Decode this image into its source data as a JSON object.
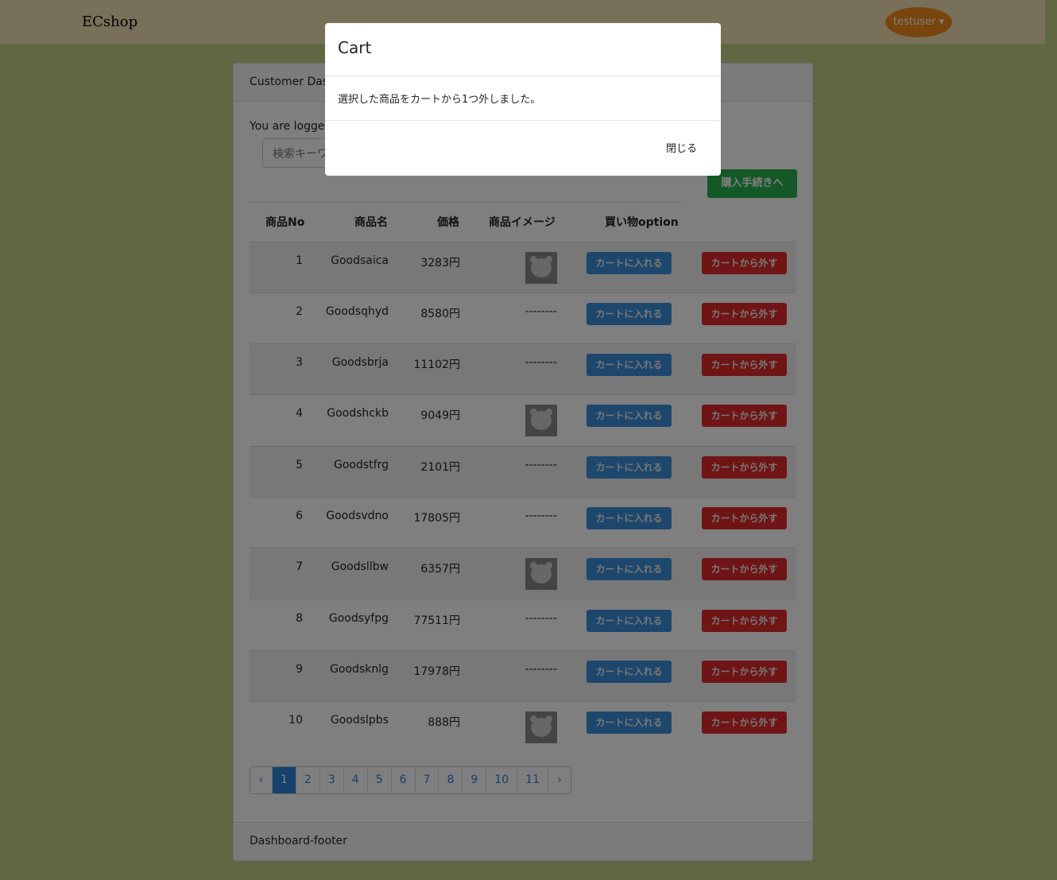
{
  "navbar": {
    "brand": "ECshop",
    "user": "testuser ▾"
  },
  "card": {
    "header": "Customer Dashboard",
    "logged_text": "You are logged in!",
    "search_placeholder": "検索キーワード",
    "checkout_label": "購入手続きへ",
    "footer": "Dashboard-footer"
  },
  "table": {
    "headers": [
      "商品No",
      "商品名",
      "価格",
      "商品イメージ",
      "買い物option"
    ],
    "add_label": "カートに入れる",
    "remove_label": "カートから外す",
    "no_image": "--------",
    "rows": [
      {
        "no": "1",
        "name": "Goodsaica",
        "price": "3283円",
        "image": true
      },
      {
        "no": "2",
        "name": "Goodsqhyd",
        "price": "8580円",
        "image": false
      },
      {
        "no": "3",
        "name": "Goodsbrja",
        "price": "11102円",
        "image": false
      },
      {
        "no": "4",
        "name": "Goodshckb",
        "price": "9049円",
        "image": true
      },
      {
        "no": "5",
        "name": "Goodstfrg",
        "price": "2101円",
        "image": false
      },
      {
        "no": "6",
        "name": "Goodsvdno",
        "price": "17805円",
        "image": false
      },
      {
        "no": "7",
        "name": "Goodsllbw",
        "price": "6357円",
        "image": true
      },
      {
        "no": "8",
        "name": "Goodsyfpg",
        "price": "77511円",
        "image": false
      },
      {
        "no": "9",
        "name": "Goodsknlg",
        "price": "17978円",
        "image": false
      },
      {
        "no": "10",
        "name": "Goodslpbs",
        "price": "888円",
        "image": true
      }
    ]
  },
  "pagination": {
    "prev": "‹",
    "pages": [
      "1",
      "2",
      "3",
      "4",
      "5",
      "6",
      "7",
      "8",
      "9",
      "10",
      "11"
    ],
    "current": "1",
    "next": "›"
  },
  "modal": {
    "title": "Cart",
    "message": "選択した商品をカートから1つ外しました。",
    "close_label": "閉じる"
  }
}
